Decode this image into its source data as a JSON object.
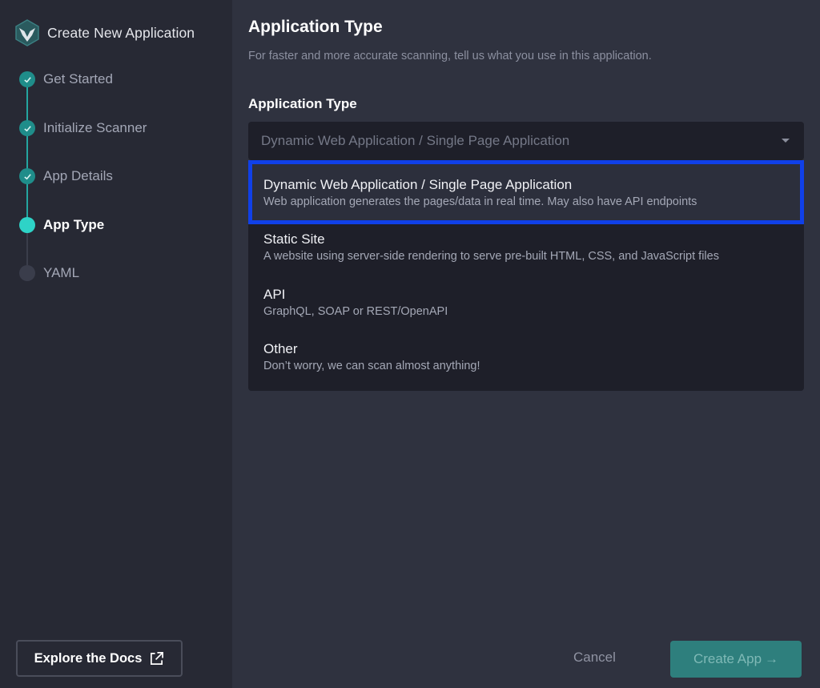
{
  "sidebar": {
    "title": "Create New Application",
    "steps": [
      {
        "label": "Get Started",
        "state": "done"
      },
      {
        "label": "Initialize Scanner",
        "state": "done"
      },
      {
        "label": "App Details",
        "state": "done"
      },
      {
        "label": "App Type",
        "state": "current"
      },
      {
        "label": "YAML",
        "state": "todo"
      }
    ],
    "docs_label": "Explore the Docs"
  },
  "main": {
    "title": "Application Type",
    "subtitle": "For faster and more accurate scanning, tell us what you use in this application.",
    "field_label": "Application Type",
    "select_value": "Dynamic Web Application / Single Page Application",
    "options": [
      {
        "title": "Dynamic Web Application / Single Page Application",
        "desc": "Web application generates the pages/data in real time. May also have API endpoints",
        "selected": true
      },
      {
        "title": "Static Site",
        "desc": "A website using server-side rendering to serve pre-built HTML, CSS, and JavaScript files"
      },
      {
        "title": "API",
        "desc": "GraphQL, SOAP or REST/OpenAPI"
      },
      {
        "title": "Other",
        "desc": "Don’t worry, we can scan almost anything!"
      }
    ]
  },
  "footer": {
    "cancel_label": "Cancel",
    "create_label": "Create App",
    "create_arrow": "→"
  },
  "colors": {
    "accent": "#2ed3c7",
    "done": "#1f8d8a",
    "highlight_border": "#1040e8"
  }
}
